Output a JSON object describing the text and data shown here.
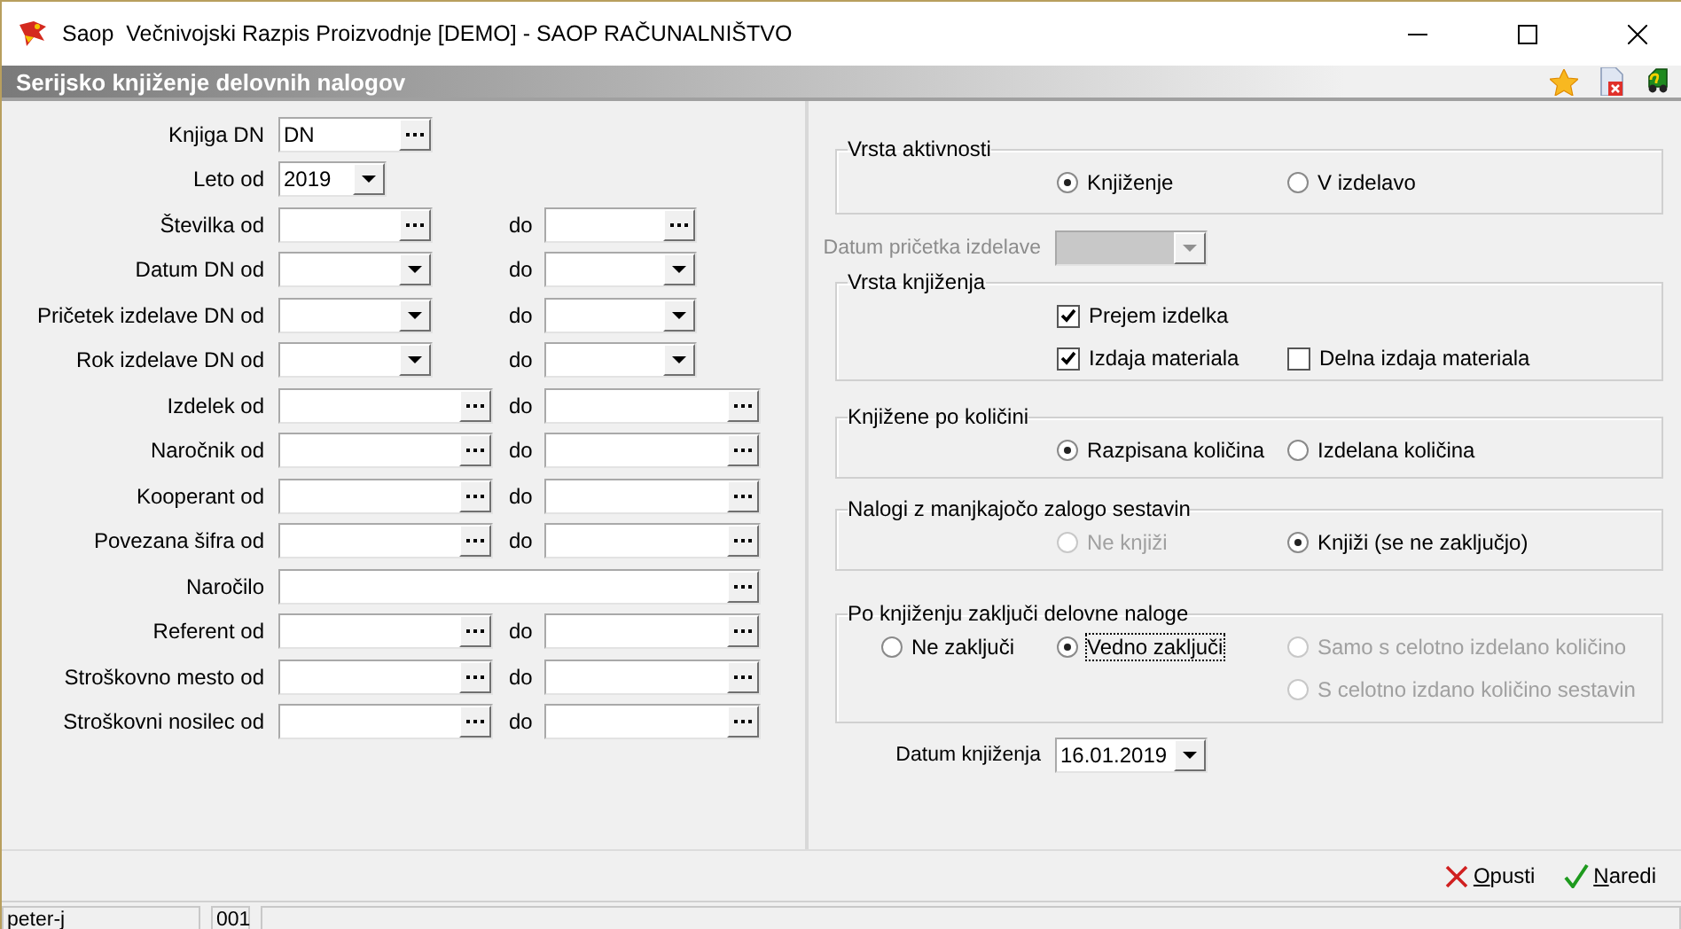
{
  "window": {
    "title": "Saop  Večnivojski Razpis Proizvodnje [DEMO] - SAOP RAČUNALNIŠTVO"
  },
  "header": {
    "title": "Serijsko knjiženje delovnih nalogov"
  },
  "filters": [
    {
      "label": "Knjiga DN",
      "kind": "book",
      "value": "DN"
    },
    {
      "label": "Leto od",
      "kind": "year",
      "value": "2019"
    },
    {
      "label": "Številka od",
      "kind": "number",
      "to_label": "do"
    },
    {
      "label": "Datum DN od",
      "kind": "date",
      "to_label": "do"
    },
    {
      "label": "Pričetek izdelave DN od",
      "kind": "date",
      "to_label": "do"
    },
    {
      "label": "Rok izdelave DN od",
      "kind": "date",
      "to_label": "do"
    },
    {
      "label": "Izdelek od",
      "kind": "lookup",
      "to_label": "do"
    },
    {
      "label": "Naročnik od",
      "kind": "lookup",
      "to_label": "do"
    },
    {
      "label": "Kooperant od",
      "kind": "lookup",
      "to_label": "do"
    },
    {
      "label": "Povezana šifra od",
      "kind": "lookup",
      "to_label": "do"
    },
    {
      "label": "Naročilo",
      "kind": "text"
    },
    {
      "label": "Referent od",
      "kind": "lookup",
      "to_label": "do"
    },
    {
      "label": "Stroškovno mesto od",
      "kind": "lookup",
      "to_label": "do"
    },
    {
      "label": "Stroškovni nosilec od",
      "kind": "lookup",
      "to_label": "do"
    }
  ],
  "activity": {
    "title": "Vrsta aktivnosti",
    "options": [
      {
        "label": "Knjiženje",
        "kind": "radio",
        "selected": true,
        "disabled": false,
        "focused": false
      },
      {
        "label": "V izdelavo",
        "kind": "radio",
        "selected": false,
        "disabled": false,
        "focused": false
      }
    ]
  },
  "start_date": {
    "label": "Datum pričetka izdelave",
    "disabled": true
  },
  "groups": [
    {
      "title": "Vrsta knjiženja",
      "options": [
        {
          "label": "Prejem izdelka",
          "kind": "checkbox",
          "checked": true,
          "disabled": false,
          "focused": false
        },
        {
          "label": "Izdaja materiala",
          "kind": "checkbox",
          "checked": true,
          "disabled": false,
          "focused": false
        },
        {
          "label": "Delna izdaja materiala",
          "kind": "checkbox",
          "checked": false,
          "disabled": false,
          "focused": false
        }
      ]
    },
    {
      "title": "Knjižene po količini",
      "options": [
        {
          "label": "Razpisana količina",
          "kind": "radio",
          "selected": true,
          "disabled": false,
          "focused": false
        },
        {
          "label": "Izdelana količina",
          "kind": "radio",
          "selected": false,
          "disabled": false,
          "focused": false
        }
      ]
    },
    {
      "title": "Nalogi z manjkajočo zalogo sestavin",
      "options": [
        {
          "label": "Ne knjiži",
          "kind": "radio",
          "selected": false,
          "disabled": true,
          "focused": false
        },
        {
          "label": "Knjiži (se ne zaključjo)",
          "kind": "radio",
          "selected": true,
          "disabled": false,
          "focused": false
        }
      ]
    },
    {
      "title": "Po knjiženju zaključi delovne naloge",
      "options": [
        {
          "label": "Ne zaključi",
          "kind": "radio",
          "selected": false,
          "disabled": false,
          "focused": false
        },
        {
          "label": "Vedno zaključi",
          "kind": "radio",
          "selected": true,
          "disabled": false,
          "focused": true
        },
        {
          "label": "Samo s celotno izdelano količino",
          "kind": "radio",
          "selected": false,
          "disabled": true,
          "focused": false
        },
        {
          "label": "S celotno izdano količino sestavin",
          "kind": "radio",
          "selected": false,
          "disabled": true,
          "focused": false
        }
      ]
    }
  ],
  "posting_date": {
    "label": "Datum knjiženja",
    "value": "16.01.2019"
  },
  "buttons": [
    {
      "label": "Opusti",
      "kind": "cancel"
    },
    {
      "label": "Naredi",
      "kind": "ok"
    }
  ],
  "status_bar": [
    "peter-j",
    "001"
  ]
}
